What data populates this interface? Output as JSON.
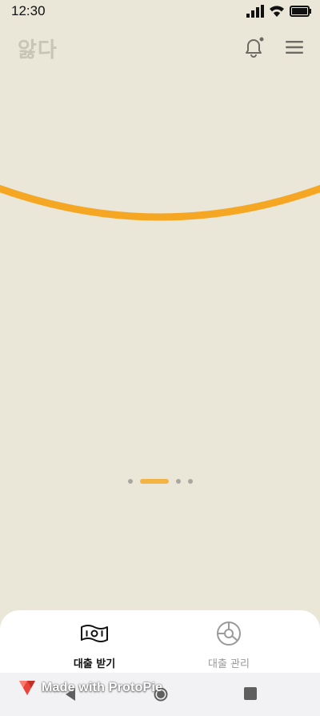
{
  "status_bar": {
    "time": "12:30",
    "icons": [
      "signal-icon",
      "wifi-icon",
      "battery-icon"
    ]
  },
  "header": {
    "brand": "앓다",
    "icons": [
      "bell-icon",
      "hamburger-menu-icon"
    ]
  },
  "pager": {
    "count": 4,
    "active_index": 1
  },
  "tab_bar": {
    "tabs": [
      {
        "label": "대출 받기",
        "icon": "banknote-icon",
        "selected": true
      },
      {
        "label": "대출 관리",
        "icon": "pie-chart-icon",
        "selected": false
      }
    ]
  },
  "watermark": {
    "text": "Made with ProtoPie",
    "icon": "protopie-logo-icon"
  },
  "colors": {
    "background": "#EAE6D8",
    "accent": "#F5A623",
    "dot_inactive": "#A9A79F",
    "dot_active": "#F3B443",
    "icon_gray": "#6B6A63"
  },
  "system_nav": {
    "icons": [
      "back-icon",
      "home-icon",
      "recents-icon"
    ]
  }
}
